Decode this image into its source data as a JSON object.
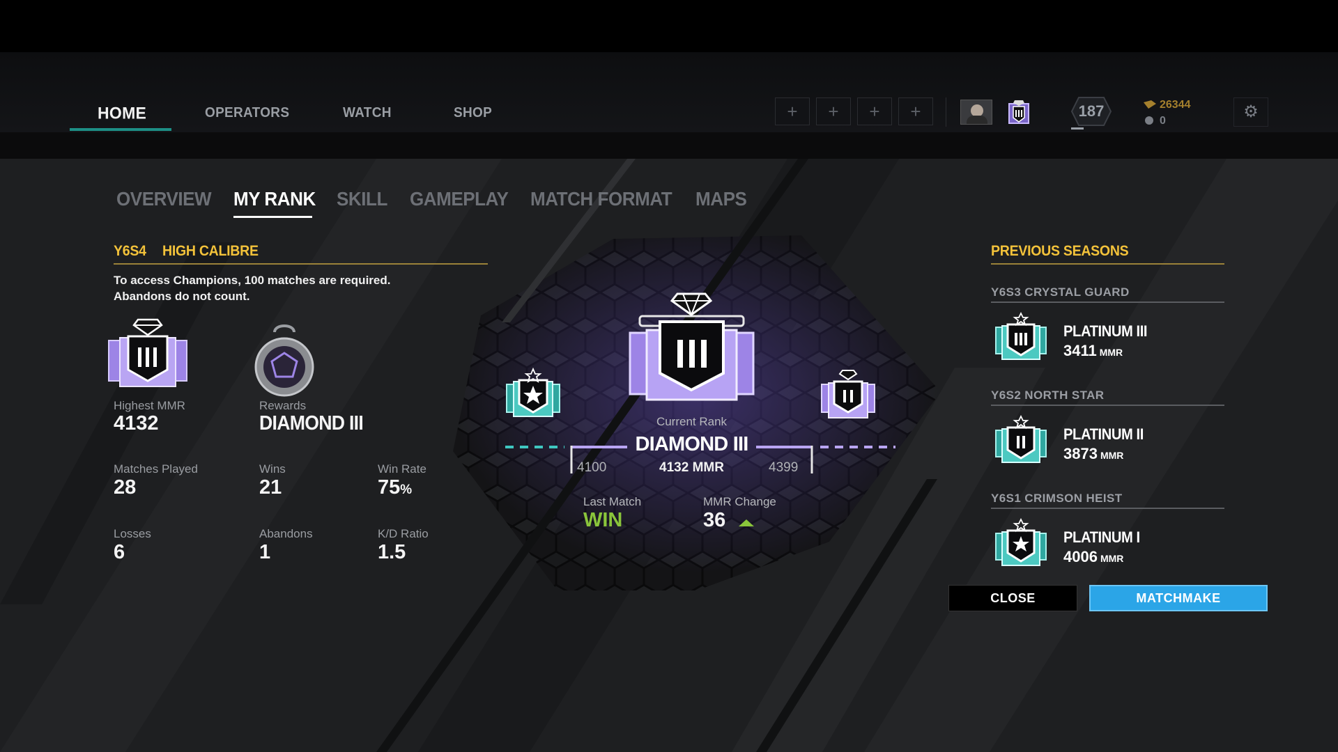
{
  "nav": {
    "items": [
      "HOME",
      "OPERATORS",
      "WATCH",
      "SHOP"
    ],
    "party_slot_glyph": "+",
    "level": "187",
    "renown": "26344",
    "r6_credits": "0",
    "settings_icon": "gear-icon"
  },
  "tabs": [
    "OVERVIEW",
    "MY RANK",
    "SKILL",
    "GAMEPLAY",
    "MATCH FORMAT",
    "MAPS"
  ],
  "season": {
    "id": "Y6S4",
    "name": "HIGH CALIBRE",
    "note_line1": "To access Champions, 100 matches are required.",
    "note_line2": "Abandons do not count."
  },
  "stats": {
    "highest_mmr_label": "Highest MMR",
    "highest_mmr": "4132",
    "rewards_label": "Rewards",
    "rewards": "DIAMOND III",
    "matches_label": "Matches Played",
    "matches": "28",
    "wins_label": "Wins",
    "wins": "21",
    "winrate_label": "Win Rate",
    "winrate": "75",
    "winrate_unit": "%",
    "losses_label": "Losses",
    "losses": "6",
    "abandons_label": "Abandons",
    "abandons": "1",
    "kd_label": "K/D Ratio",
    "kd": "1.5"
  },
  "current": {
    "label": "Current Rank",
    "rank": "DIAMOND III",
    "min": "4100",
    "mmr": "4132 MMR",
    "max": "4399",
    "progress": 0.11,
    "last_match_label": "Last Match",
    "last_match": "WIN",
    "mmr_change_label": "MMR Change",
    "mmr_change": "36"
  },
  "previous": {
    "title": "PREVIOUS SEASONS",
    "seasons": [
      {
        "season": "Y6S3  CRYSTAL GUARD",
        "rank": "PLATINUM III",
        "mmr": "3411",
        "unit": "MMR"
      },
      {
        "season": "Y6S2  NORTH STAR",
        "rank": "PLATINUM II",
        "mmr": "3873",
        "unit": "MMR"
      },
      {
        "season": "Y6S1  CRIMSON HEIST",
        "rank": "PLATINUM I",
        "mmr": "4006",
        "unit": "MMR"
      }
    ]
  },
  "buttons": {
    "close": "CLOSE",
    "matchmake": "MATCHMAKE"
  },
  "colors": {
    "accent_gold": "#f3c23a",
    "diamond_purple": "#a88af0",
    "platinum_teal": "#3fc7c0",
    "matchmake_blue": "#2ba5e7",
    "win_green": "#8ac53b",
    "nav_active_underline": "#1d8f86"
  }
}
